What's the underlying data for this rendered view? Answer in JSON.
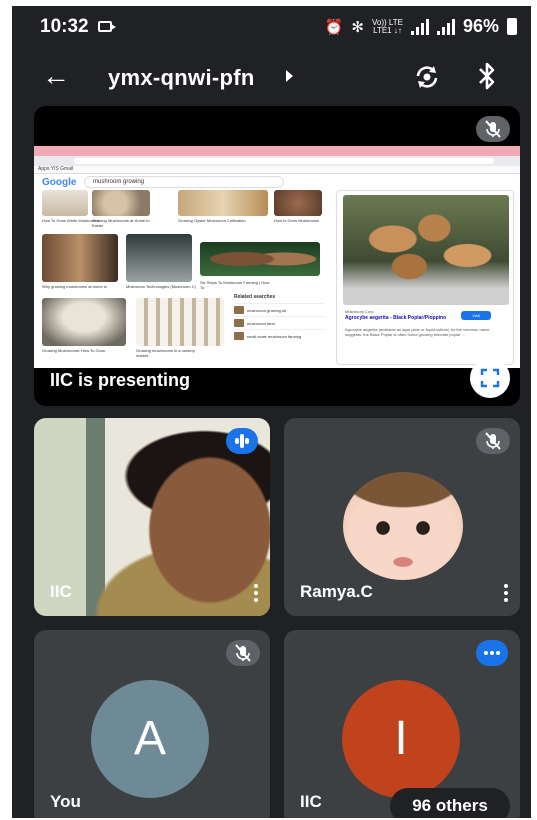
{
  "status_bar": {
    "time": "10:32",
    "network_top": "Vo)) LTE",
    "network_bottom": "LTE1 ↓↑",
    "battery": "96%"
  },
  "top_bar": {
    "meeting_code": "ymx-qnwi-pfn"
  },
  "presentation": {
    "label": "IIC is presenting",
    "screen": {
      "google_logo": "Google",
      "search_query": "mushroom growing",
      "bookmarks": "Apps  YIS  Gmail",
      "thumbnail_captions": [
        "How To Grow White Mushrooms",
        "Growing Mushrooms at Home to Easier",
        "Growing Oyster Mushroom Cultivation",
        "How to Grow Mushrooms",
        "Why growing mushrooms at home is",
        "Mushroom Technologies (Mushroom C)",
        "Six Steps To Mushroom Farming | How To",
        "Growing Mushrooms: How To Grow",
        "Growing mushrooms in a nursery market"
      ],
      "related_heading": "Related searches",
      "related_items": [
        "mushroom growing kit",
        "mushroom farm",
        "small scale mushroom farming"
      ],
      "side_source": "Mushroom Corp",
      "side_title": "Agrocybe aegerita - Black Poplar/Pioppino",
      "visit_label": "Visit",
      "side_description": "Agrocybe aegerita (available as agar plate or liquid culture) for the common name suggests, the Black Poplar is often found growing beneath poplar ..."
    }
  },
  "participants": [
    {
      "name": "IIC",
      "state": "speaking"
    },
    {
      "name": "Ramya.C",
      "state": "muted"
    },
    {
      "name": "You",
      "initial": "A",
      "state": "muted",
      "avatar_color": "#6e8a96"
    },
    {
      "name": "IIC",
      "initial": "I",
      "state": "speaking",
      "avatar_color": "#c0431e"
    }
  ],
  "others_count": "96 others",
  "colors": {
    "background": "#202124",
    "tile": "#3c4043",
    "speaking_blue": "#1a73e8",
    "mute_grey": "#5f6368"
  },
  "icons": [
    "back-arrow-icon",
    "dropdown-caret-icon",
    "switch-camera-icon",
    "bluetooth-icon",
    "mic-off-icon",
    "fullscreen-icon",
    "more-vert-icon",
    "speaking-indicator-icon"
  ]
}
